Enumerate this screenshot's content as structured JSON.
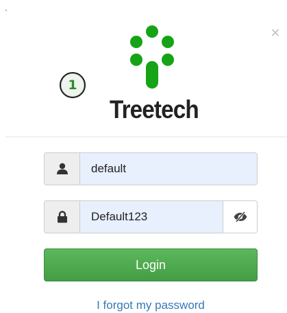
{
  "window": {
    "close_glyph": "×"
  },
  "branding": {
    "logo_icon": "treetech-tree-logo-icon",
    "name": "Treetech",
    "accent_color": "#16a316"
  },
  "annotation": {
    "step_number": "1"
  },
  "form": {
    "username": {
      "icon": "user-icon",
      "value": "default"
    },
    "password": {
      "icon": "lock-icon",
      "value": "Default123",
      "toggle_icon": "eye-slash-icon"
    },
    "login_label": "Login",
    "forgot_label": "I forgot my password"
  },
  "colors": {
    "login_button": "#4cae4c",
    "link": "#337ab7",
    "autofill_background": "#e8f0fe"
  }
}
